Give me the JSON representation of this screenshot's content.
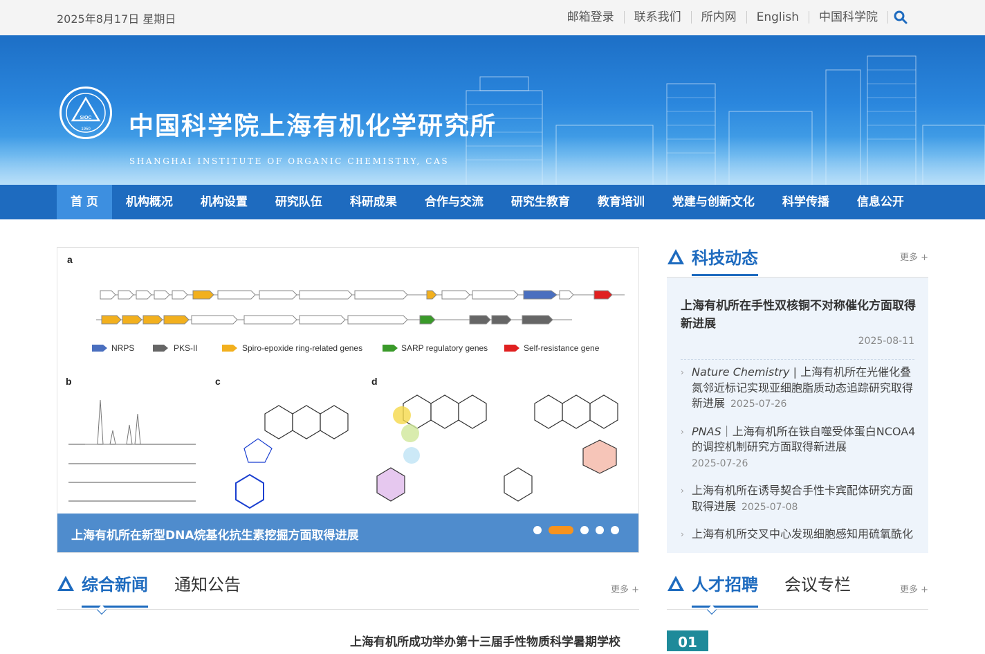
{
  "topbar": {
    "date": "2025年8月17日 星期日",
    "links": [
      "邮箱登录",
      "联系我们",
      "所内网",
      "English",
      "中国科学院"
    ]
  },
  "banner": {
    "title_cn": "中国科学院上海有机化学研究所",
    "title_en": "SHANGHAI INSTITUTE OF ORGANIC CHEMISTRY, CAS",
    "logo_text": "SIOC",
    "logo_year": "1950"
  },
  "nav": [
    "首 页",
    "机构概况",
    "机构设置",
    "研究队伍",
    "科研成果",
    "合作与交流",
    "研究生教育",
    "教育培训",
    "党建与创新文化",
    "科学传播",
    "信息公开"
  ],
  "slider": {
    "caption": "上海有机所在新型DNA烷基化抗生素挖掘方面取得进展",
    "dot_count": 5,
    "active_dot": 1,
    "figure_labels": [
      "a",
      "b",
      "c",
      "d"
    ],
    "legend": [
      "NRPS",
      "PKS-II",
      "Spiro-epoxide ring-related genes",
      "SARP regulatory genes",
      "Self-resistance gene"
    ]
  },
  "tech_news": {
    "title": "科技动态",
    "more": "更多 +",
    "lead": {
      "title": "上海有机所在手性双核铜不对称催化方面取得新进展",
      "date": "2025-08-11"
    },
    "items": [
      {
        "journal": "Nature Chemistry",
        "sep": " | ",
        "title": "上海有机所在光催化叠氮邻近标记实现亚细胞脂质动态追踪研究取得新进展",
        "date": "2025-07-26"
      },
      {
        "journal": "PNAS",
        "sep": "｜",
        "title": "上海有机所在铁自噬受体蛋白NCOA4的调控机制研究方面取得新进展",
        "date": "2025-07-26"
      },
      {
        "journal": "",
        "sep": "",
        "title": "上海有机所在诱导契合手性卡宾配体研究方面取得进展",
        "date": "2025-07-08"
      },
      {
        "journal": "",
        "sep": "",
        "title": "上海有机所交叉中心发现细胞感知用硫氧酰化",
        "date": ""
      }
    ]
  },
  "bottom_left": {
    "tab1": "综合新闻",
    "tab2": "通知公告",
    "more": "更多 +",
    "headline": "上海有机所成功举办第十三届手性物质科学暑期学校"
  },
  "bottom_right": {
    "tab1": "人才招聘",
    "tab2": "会议专栏",
    "more": "更多 +",
    "badge": "01"
  }
}
